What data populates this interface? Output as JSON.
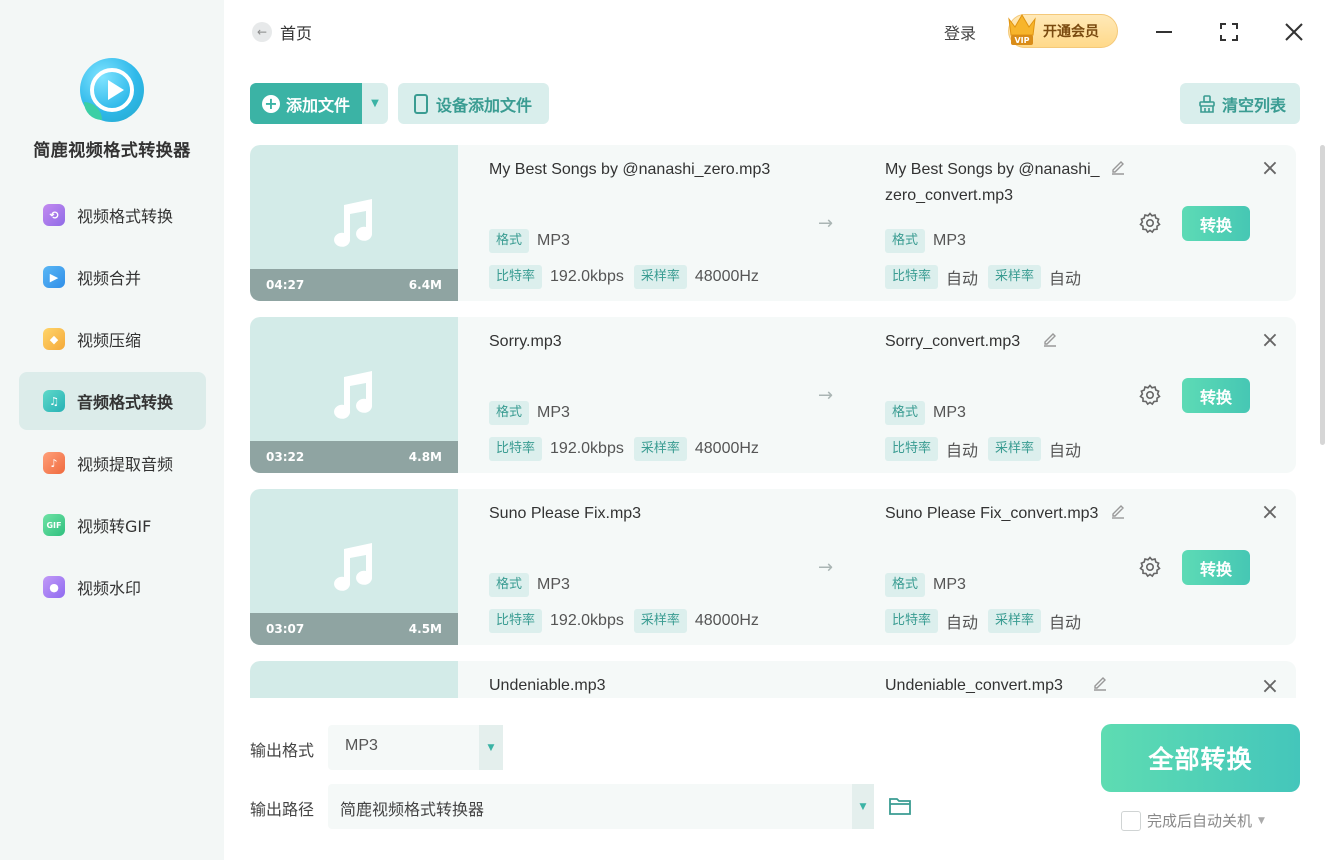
{
  "app": {
    "name": "简鹿视频格式转换器"
  },
  "sidebar": {
    "items": [
      {
        "label": "视频格式转换",
        "icon": "video-convert-icon",
        "color": "#b07be6"
      },
      {
        "label": "视频合并",
        "icon": "video-merge-icon",
        "color": "#3aa3f0"
      },
      {
        "label": "视频压缩",
        "icon": "video-compress-icon",
        "color": "#f4b740"
      },
      {
        "label": "音频格式转换",
        "icon": "audio-convert-icon",
        "color": "#2fc0b5",
        "active": true
      },
      {
        "label": "视频提取音频",
        "icon": "extract-audio-icon",
        "color": "#f07a4a"
      },
      {
        "label": "视频转GIF",
        "icon": "gif-icon",
        "color": "#3fcf8a"
      },
      {
        "label": "视频水印",
        "icon": "watermark-icon",
        "color": "#a678f0"
      }
    ]
  },
  "header": {
    "back_label": "首页",
    "login_label": "登录",
    "vip_label": "开通会员"
  },
  "toolbar": {
    "add_file_label": "添加文件",
    "device_add_label": "设备添加文件",
    "clear_label": "清空列表"
  },
  "tags": {
    "format": "格式",
    "bitrate": "比特率",
    "samplerate": "采样率"
  },
  "files": [
    {
      "src_name": "My Best Songs by @nanashi_zero.mp3",
      "dst_name": "My Best Songs by @nanashi_zero_convert.mp3",
      "duration": "04:27",
      "size": "6.4M",
      "src_format": "MP3",
      "src_bitrate": "192.0kbps",
      "src_samplerate": "48000Hz",
      "dst_format": "MP3",
      "dst_bitrate": "自动",
      "dst_samplerate": "自动",
      "convert_label": "转换"
    },
    {
      "src_name": "Sorry.mp3",
      "dst_name": "Sorry_convert.mp3",
      "duration": "03:22",
      "size": "4.8M",
      "src_format": "MP3",
      "src_bitrate": "192.0kbps",
      "src_samplerate": "48000Hz",
      "dst_format": "MP3",
      "dst_bitrate": "自动",
      "dst_samplerate": "自动",
      "convert_label": "转换"
    },
    {
      "src_name": "Suno Please Fix.mp3",
      "dst_name": "Suno Please Fix_convert.mp3",
      "duration": "03:07",
      "size": "4.5M",
      "src_format": "MP3",
      "src_bitrate": "192.0kbps",
      "src_samplerate": "48000Hz",
      "dst_format": "MP3",
      "dst_bitrate": "自动",
      "dst_samplerate": "自动",
      "convert_label": "转换"
    },
    {
      "src_name": "Undeniable.mp3",
      "dst_name": "Undeniable_convert.mp3"
    }
  ],
  "bottom": {
    "output_format_label": "输出格式",
    "output_format_value": "MP3",
    "output_path_label": "输出路径",
    "output_path_value": "简鹿视频格式转换器",
    "convert_all_label": "全部转换",
    "auto_shutdown_label": "完成后自动关机"
  }
}
